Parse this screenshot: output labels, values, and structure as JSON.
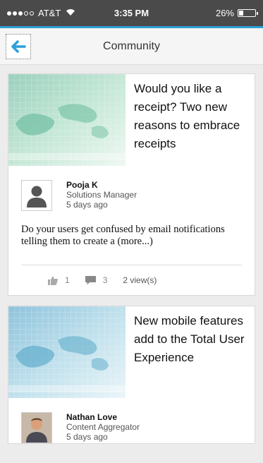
{
  "status_bar": {
    "carrier": "AT&T",
    "time": "3:35 PM",
    "battery": "26%",
    "battery_level": 0.26
  },
  "header": {
    "title": "Community",
    "back_icon": "back-arrow-icon"
  },
  "colors": {
    "accent": "#2c9fd8",
    "status_bar_bg": "#4a4a4a"
  },
  "posts": [
    {
      "title": "Would you like a receipt? Two new reasons to embrace receipts",
      "author": "Pooja K",
      "role": "Solutions Manager",
      "time_ago": "5 days ago",
      "excerpt": "Do your users get confused by email notifications telling them to create a",
      "more": "(more...)",
      "likes": "1",
      "comments": "3",
      "views": "2 view(s)"
    },
    {
      "title": "New mobile features add to the Total User Experience",
      "author": "Nathan Love",
      "role": "Content Aggregator",
      "time_ago": "5 days ago"
    }
  ]
}
